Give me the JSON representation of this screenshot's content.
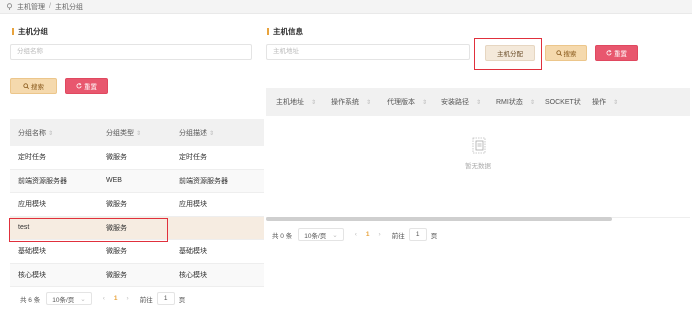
{
  "breadcrumb": {
    "parent": "主机管理",
    "separator": "/",
    "current": "主机分组"
  },
  "left": {
    "title": "主机分组",
    "search_placeholder": "分组名称",
    "search_label": "搜索",
    "reset_label": "重置",
    "columns": [
      "分组名称",
      "分组类型",
      "分组描述"
    ],
    "rows": [
      [
        "定时任务",
        "微服务",
        "定时任务"
      ],
      [
        "前端资源服务器",
        "WEB",
        "前端资源服务器"
      ],
      [
        "应用模块",
        "微服务",
        "应用模块"
      ],
      [
        "test",
        "微服务",
        ""
      ],
      [
        "基础模块",
        "微服务",
        "基础模块"
      ],
      [
        "核心模块",
        "微服务",
        "核心模块"
      ]
    ],
    "selected_row": 3,
    "pager": {
      "total": "共 6 条",
      "size": "10条/页",
      "page": "1",
      "goto": "前往",
      "goto_value": "1",
      "page_suffix": "页"
    }
  },
  "right": {
    "title": "主机信息",
    "search_placeholder": "主机地址",
    "assign_label": "主机分配",
    "search_label": "搜索",
    "reset_label": "重置",
    "columns": [
      "主机地址",
      "操作系统",
      "代理版本",
      "安装路径",
      "RMI状态",
      "SOCKET状",
      "操作"
    ],
    "empty_text": "暂无数据",
    "pager": {
      "total": "共 0 条",
      "size": "10条/页",
      "page": "1",
      "goto": "前往",
      "goto_value": "1",
      "page_suffix": "页"
    }
  },
  "colors": {
    "accent": "#e8a33d",
    "danger": "#e8576e",
    "highlight": "#e0303c"
  },
  "icons": {
    "breadcrumb": "location-pin-icon",
    "search": "search-icon",
    "reset": "refresh-icon",
    "sort": "sort-icon",
    "empty": "empty-document-icon"
  }
}
